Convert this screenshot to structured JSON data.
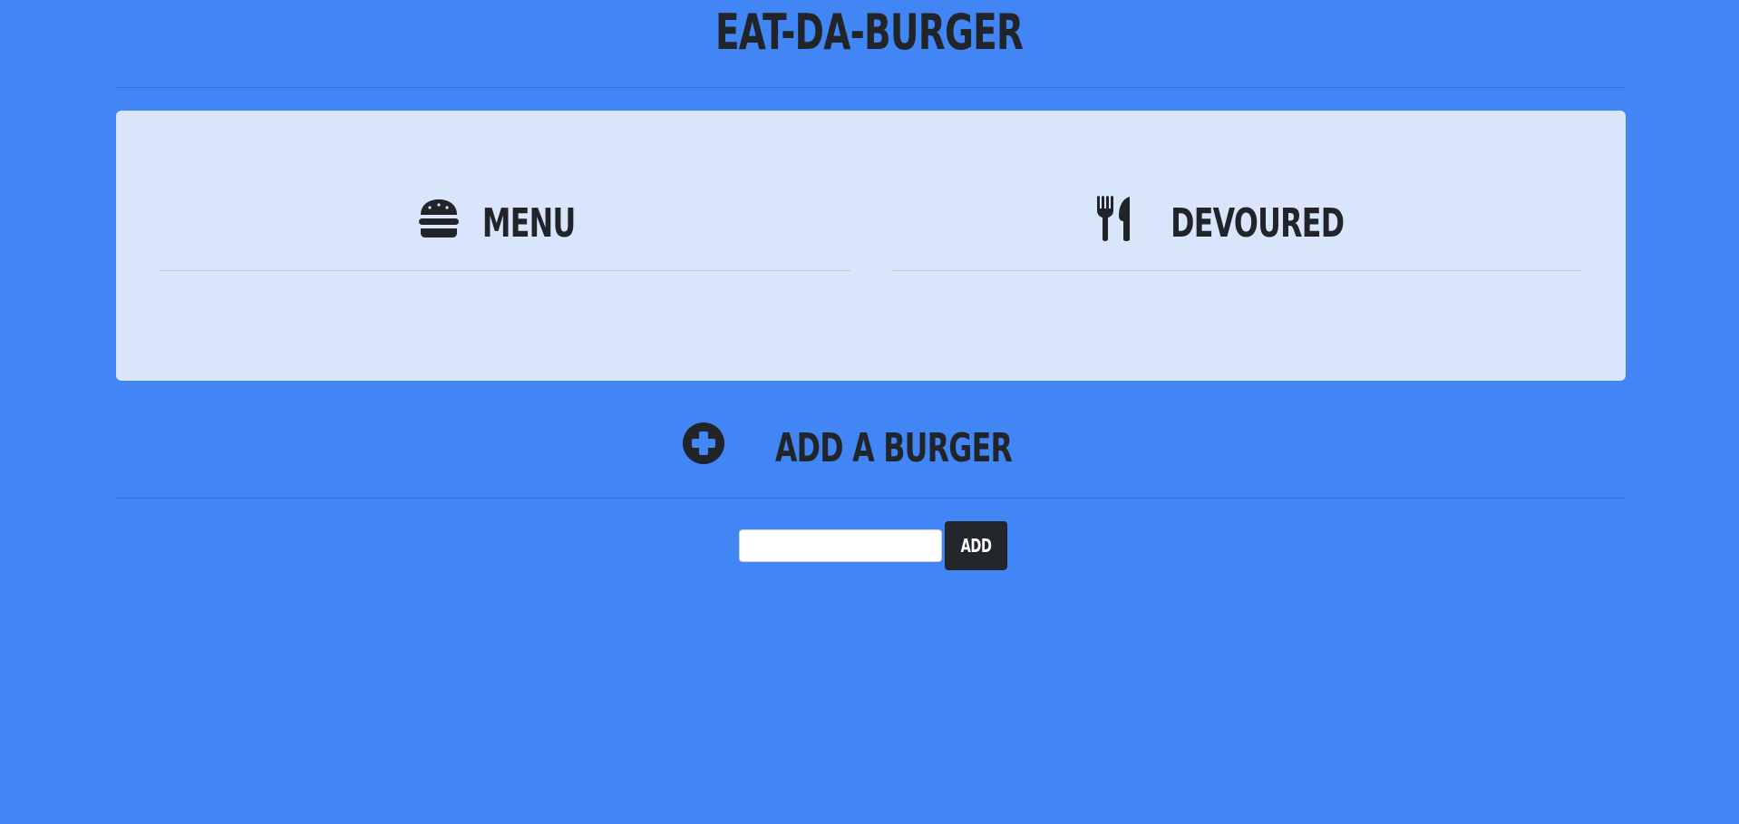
{
  "header": {
    "title": "EAT-DA-BURGER"
  },
  "menu_column": {
    "label": "MENU",
    "icon": "hamburger-icon"
  },
  "devoured_column": {
    "label": "DEVOURED",
    "icon": "utensils-icon"
  },
  "add_section": {
    "label": "ADD A BURGER",
    "icon": "plus-circle-icon",
    "input_value": "",
    "input_placeholder": "",
    "button_label": "ADD"
  },
  "colors": {
    "background": "#4285f4",
    "panel": "#d8e5fb",
    "text": "#212529",
    "button": "#23272b"
  }
}
